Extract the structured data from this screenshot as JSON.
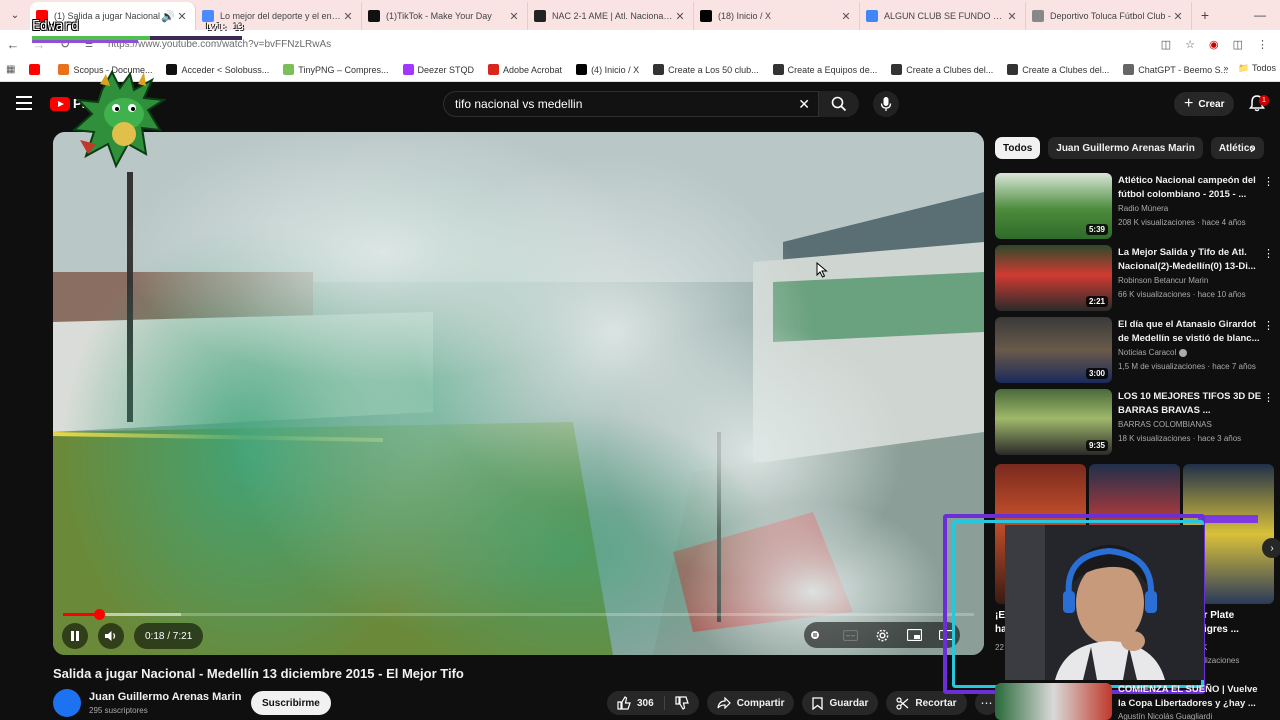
{
  "browser": {
    "tabs": [
      {
        "label": "(1) Salida a jugar Nacional",
        "fav_color": "#ff0000",
        "active": true
      },
      {
        "label": "Lo mejor del deporte y el entre",
        "fav_color": "#4a8cff",
        "active": false
      },
      {
        "label": "(1)TikTok - Make Your Day",
        "fav_color": "#111111",
        "active": false
      },
      {
        "label": "NAC 2-1 AME | Atl. Nacional vs",
        "fav_color": "#222222",
        "active": false
      },
      {
        "label": "(18) Inicio / X",
        "fav_color": "#000000",
        "active": false
      },
      {
        "label": "ALGUN CLUB SE FUNDO EL 28",
        "fav_color": "#4285f4",
        "active": false
      },
      {
        "label": "Deportivo Toluca Fútbol Club -",
        "fav_color": "#888888",
        "active": false
      }
    ],
    "url": "https://www.youtube.com/watch?v=bvFFNzLRwAs",
    "bookmarks": [
      {
        "label": "",
        "color": "#ff0000"
      },
      {
        "label": "Scopus - Docume...",
        "color": "#e9711c"
      },
      {
        "label": "Acceder < Solobuss...",
        "color": "#111111"
      },
      {
        "label": "TinyPNG – Compres...",
        "color": "#7bbf5a"
      },
      {
        "label": "Deezer STQD",
        "color": "#a238ff"
      },
      {
        "label": "Adobe Acrobat",
        "color": "#d9261c"
      },
      {
        "label": "(4) Inicio / X",
        "color": "#000000"
      },
      {
        "label": "Create a Los 50 club...",
        "color": "#333333"
      },
      {
        "label": "Create a Equipos de...",
        "color": "#333333"
      },
      {
        "label": "Create a Clubes del...",
        "color": "#333333"
      },
      {
        "label": "Create a Clubes del...",
        "color": "#333333"
      },
      {
        "label": "ChatGPT - Beemo S...",
        "color": "#666666"
      }
    ],
    "all_bookmarks_label": "Todos"
  },
  "overlay": {
    "name": "Edward",
    "level": "Lvl: 13",
    "xp_progress": 0.56
  },
  "header": {
    "logo_text": "Premi",
    "search_value": "tifo nacional vs medellin",
    "create_label": "Crear",
    "notification_count": "1"
  },
  "player": {
    "time": "0:18 / 7:21",
    "played_fraction": 0.04,
    "buffered_fraction": 0.13
  },
  "video": {
    "title": "Salida a jugar Nacional - Medellín 13 diciembre 2015 - El Mejor Tifo",
    "channel": "Juan Guillermo Arenas Marin",
    "subscribers": "295 suscriptores",
    "subscribe_label": "Suscribirme",
    "likes": "306",
    "share_label": "Compartir",
    "save_label": "Guardar",
    "clip_label": "Recortar"
  },
  "sidebar": {
    "chips": [
      "Todos",
      "Juan Guillermo Arenas Marin",
      "Atlético"
    ],
    "recommendations": [
      {
        "title": "Atlético Nacional campeón del fútbol colombiano - 2015 - ...",
        "channel": "Radio Múnera",
        "meta": "208 K visualizaciones · hace 4 años",
        "duration": "5:39",
        "verified": false
      },
      {
        "title": "La Mejor Salida y Tifo de Atl. Nacional(2)-Medellín(0) 13-Di...",
        "channel": "Robinson Betancur Marin",
        "meta": "66 K visualizaciones · hace 10 años",
        "duration": "2:21",
        "verified": false
      },
      {
        "title": "El día que el Atanasio Girardot de Medellín se vistió de blanc...",
        "channel": "Noticias Caracol",
        "meta": "1,5 M de visualizaciones · hace 7 años",
        "duration": "3:00",
        "verified": true
      },
      {
        "title": "LOS 10 MEJORES TIFOS 3D DE BARRAS BRAVAS ...",
        "channel": "BARRAS COLOMBIANAS",
        "meta": "18 K visualizaciones · hace 3 años",
        "duration": "9:35",
        "verified": false
      }
    ],
    "short_left_text": "¡E",
    "short_left_text2": "ha",
    "short_left_meta": "22",
    "short_right_text": "er Plate",
    "short_right_text2": "Tigres ...",
    "short_right_meta": "K",
    "short_right_meta2": "ializaciones",
    "last_rec": {
      "title": "COMIENZA EL SUEÑO | Vuelve la Copa Libertadores y ¿hay ...",
      "channel": "Agustín Nicolás Guagliardi"
    }
  }
}
